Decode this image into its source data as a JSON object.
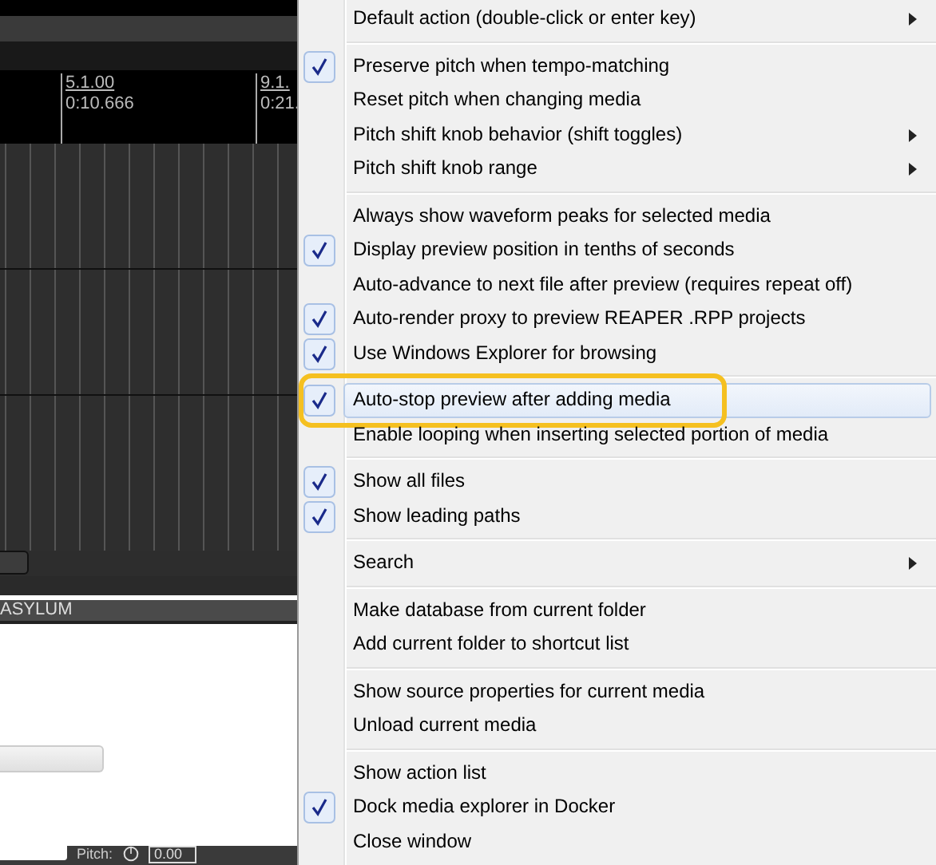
{
  "arrange": {
    "ruler": [
      {
        "bar": "5.1.00",
        "time": "0:10.666"
      },
      {
        "bar": "9.1.",
        "time": "0:21."
      }
    ]
  },
  "panel": {
    "title": "ASYLUM"
  },
  "bottom_bar": {
    "pitch_label": "Pitch:",
    "pitch_value": "0.00"
  },
  "menu": {
    "groups": [
      [
        {
          "label": "Default action (double-click or enter key)",
          "checked": false,
          "submenu": true,
          "selected": false,
          "annotated": false
        }
      ],
      [
        {
          "label": "Preserve pitch when tempo-matching",
          "checked": true,
          "submenu": false,
          "selected": false,
          "annotated": false
        },
        {
          "label": "Reset pitch when changing media",
          "checked": false,
          "submenu": false,
          "selected": false,
          "annotated": false
        },
        {
          "label": "Pitch shift knob behavior (shift toggles)",
          "checked": false,
          "submenu": true,
          "selected": false,
          "annotated": false
        },
        {
          "label": "Pitch shift knob range",
          "checked": false,
          "submenu": true,
          "selected": false,
          "annotated": false
        }
      ],
      [
        {
          "label": "Always show waveform peaks for selected media",
          "checked": false,
          "submenu": false,
          "selected": false,
          "annotated": false
        },
        {
          "label": "Display preview position in tenths of seconds",
          "checked": true,
          "submenu": false,
          "selected": false,
          "annotated": false
        },
        {
          "label": "Auto-advance to next file after preview (requires repeat off)",
          "checked": false,
          "submenu": false,
          "selected": false,
          "annotated": false
        },
        {
          "label": "Auto-render proxy to preview REAPER .RPP projects",
          "checked": true,
          "submenu": false,
          "selected": false,
          "annotated": false
        },
        {
          "label": "Use Windows Explorer for browsing",
          "checked": true,
          "submenu": false,
          "selected": false,
          "annotated": false
        }
      ],
      [
        {
          "label": "Auto-stop preview after adding media",
          "checked": true,
          "submenu": false,
          "selected": true,
          "annotated": true
        },
        {
          "label": "Enable looping when inserting selected portion of media",
          "checked": false,
          "submenu": false,
          "selected": false,
          "annotated": false
        }
      ],
      [
        {
          "label": "Show all files",
          "checked": true,
          "submenu": false,
          "selected": false,
          "annotated": false
        },
        {
          "label": "Show leading paths",
          "checked": true,
          "submenu": false,
          "selected": false,
          "annotated": false
        }
      ],
      [
        {
          "label": "Search",
          "checked": false,
          "submenu": true,
          "selected": false,
          "annotated": false
        }
      ],
      [
        {
          "label": "Make database from current folder",
          "checked": false,
          "submenu": false,
          "selected": false,
          "annotated": false
        },
        {
          "label": "Add current folder to shortcut list",
          "checked": false,
          "submenu": false,
          "selected": false,
          "annotated": false
        }
      ],
      [
        {
          "label": "Show source properties for current media",
          "checked": false,
          "submenu": false,
          "selected": false,
          "annotated": false
        },
        {
          "label": "Unload current media",
          "checked": false,
          "submenu": false,
          "selected": false,
          "annotated": false
        }
      ],
      [
        {
          "label": "Show action list",
          "checked": false,
          "submenu": false,
          "selected": false,
          "annotated": false
        },
        {
          "label": "Dock media explorer in Docker",
          "checked": true,
          "submenu": false,
          "selected": false,
          "annotated": false
        },
        {
          "label": "Close window",
          "checked": false,
          "submenu": false,
          "selected": false,
          "annotated": false
        }
      ]
    ]
  }
}
